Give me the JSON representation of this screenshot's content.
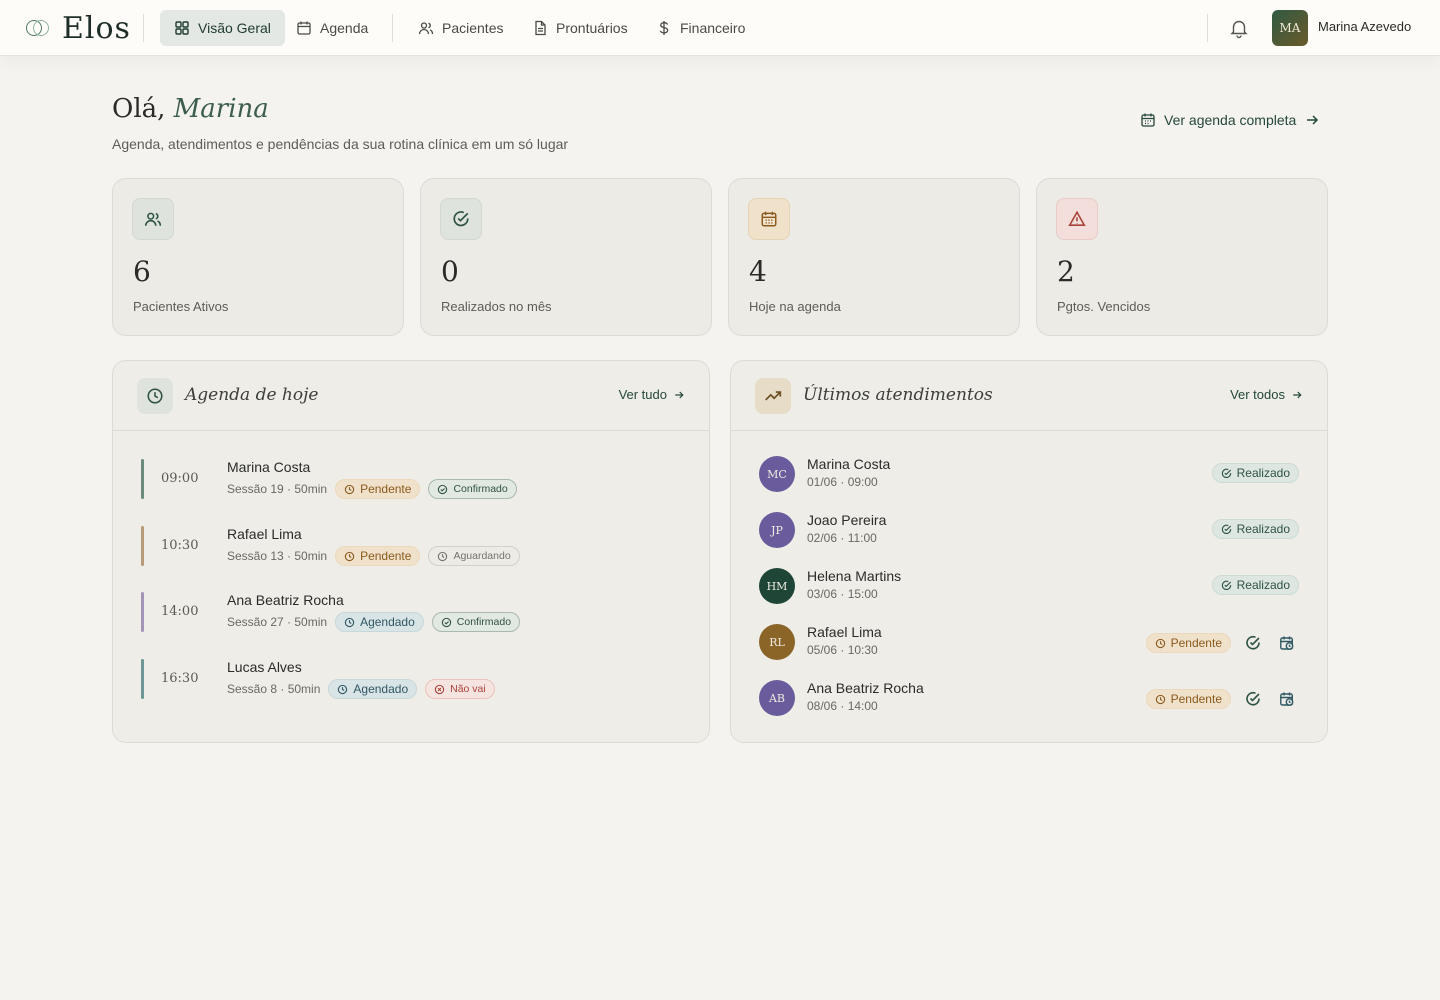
{
  "app": {
    "logo": "Elos"
  },
  "nav": [
    {
      "label": "Visão Geral",
      "icon": "grid-icon",
      "active": true
    },
    {
      "label": "Agenda",
      "icon": "calendar-icon",
      "active": false
    },
    {
      "label": "Pacientes",
      "icon": "users-icon",
      "active": false
    },
    {
      "label": "Prontuários",
      "icon": "document-icon",
      "active": false
    },
    {
      "label": "Financeiro",
      "icon": "dollar-icon",
      "active": false
    }
  ],
  "user": {
    "initials": "MA",
    "name": "Marina Azevedo"
  },
  "header": {
    "greeting": "Olá,",
    "greeting_name": "Marina",
    "subtitle": "Agenda, atendimentos e pendências da sua rotina clínica em um só lugar",
    "agenda_link": "Ver agenda completa"
  },
  "stats": [
    {
      "value": "6",
      "label": "Pacientes Ativos",
      "icon": "users-icon"
    },
    {
      "value": "0",
      "label": "Realizados no mês",
      "icon": "check-circle-icon"
    },
    {
      "value": "4",
      "label": "Hoje na agenda",
      "icon": "calendar-icon"
    },
    {
      "value": "2",
      "label": "Pgtos. Vencidos",
      "icon": "warning-icon"
    }
  ],
  "today": {
    "title": "Agenda de hoje",
    "link": "Ver tudo",
    "rows": [
      {
        "time": "09:00",
        "name": "Marina Costa",
        "meta": "Sessão 19 · 50min",
        "status": "Pendente",
        "confirm": "Confirmado",
        "bar_color": "#6b8c7d"
      },
      {
        "time": "10:30",
        "name": "Rafael Lima",
        "meta": "Sessão 13 · 50min",
        "status": "Pendente",
        "confirm": "Aguardando",
        "bar_color": "#b89b78"
      },
      {
        "time": "14:00",
        "name": "Ana Beatriz Rocha",
        "meta": "Sessão 27 · 50min",
        "status": "Agendado",
        "confirm": "Confirmado",
        "bar_color": "#a295b8"
      },
      {
        "time": "16:30",
        "name": "Lucas Alves",
        "meta": "Sessão 8 · 50min",
        "status": "Agendado",
        "confirm": "Não vai",
        "bar_color": "#6d9696"
      }
    ]
  },
  "recent": {
    "title": "Últimos atendimentos",
    "link": "Ver todos",
    "rows": [
      {
        "initials": "MC",
        "name": "Marina Costa",
        "date": "01/06 · 09:00",
        "status": "Realizado",
        "avatar_color": "#6a5c9c"
      },
      {
        "initials": "JP",
        "name": "Joao Pereira",
        "date": "02/06 · 11:00",
        "status": "Realizado",
        "avatar_color": "#6a5c9c"
      },
      {
        "initials": "HM",
        "name": "Helena Martins",
        "date": "03/06 · 15:00",
        "status": "Realizado",
        "avatar_color": "#1f4537"
      },
      {
        "initials": "RL",
        "name": "Rafael Lima",
        "date": "05/06 · 10:30",
        "status": "Pendente",
        "avatar_color": "#8b6428"
      },
      {
        "initials": "AB",
        "name": "Ana Beatriz Rocha",
        "date": "08/06 · 14:00",
        "status": "Pendente",
        "avatar_color": "#6a5c9c"
      }
    ]
  }
}
